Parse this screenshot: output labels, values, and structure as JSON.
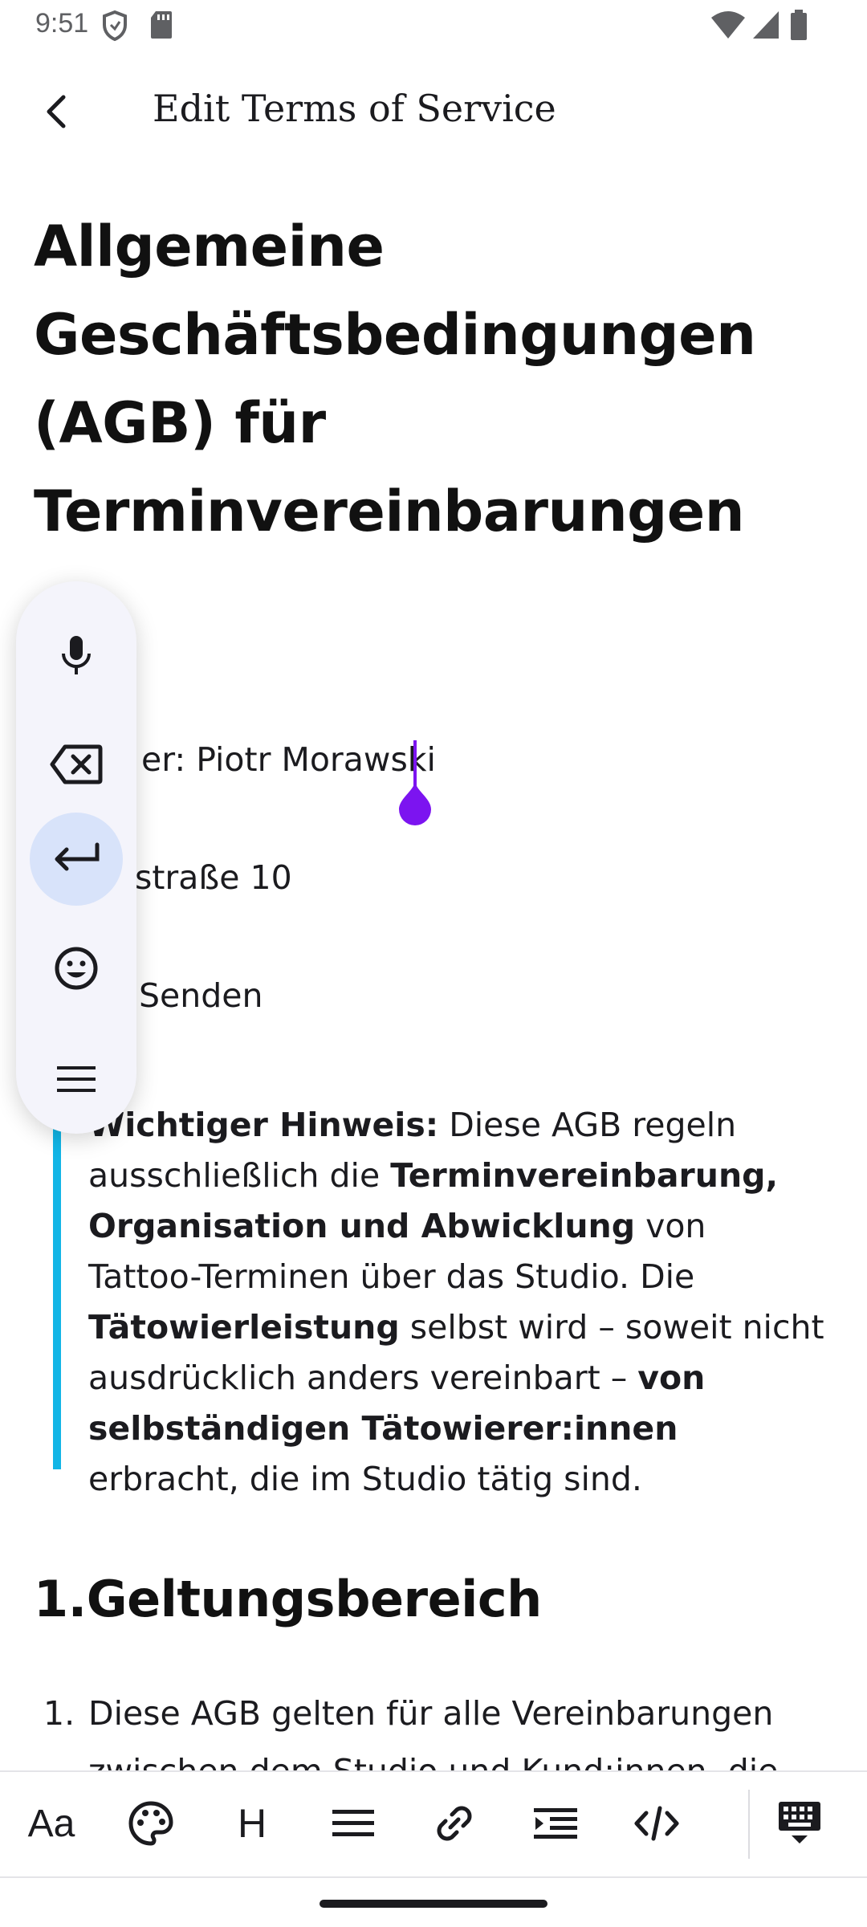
{
  "status_bar": {
    "time": "9:51"
  },
  "app_bar": {
    "title": "Edit Terms of Service"
  },
  "document": {
    "title": "Allgemeine Geschäftsbedingungen (AGB) für Terminvereinbarungen",
    "line_owner": "er: Piotr Morawski",
    "line_street": "straße 10",
    "line_city": "Senden",
    "note": {
      "p1_bold": "Wichtiger Hinweis:",
      "p1_rest": " Diese AGB regeln ausschließlich die ",
      "p2_bold": "Terminvereinbarung, Organisation und Abwicklung",
      "p2_rest": " von Tattoo-Terminen über das Studio. Die ",
      "p3_bold": "Tätowierleistung",
      "p3_rest": " selbst wird – soweit nicht ausdrücklich anders vereinbart – ",
      "p4_bold": "von selbständigen Tätowierer:innen",
      "p4_rest": " erbracht, die im Studio tätig sind."
    },
    "section_heading": "1.Geltungsbereich",
    "list_item_1_number": "1.",
    "list_item_1_text": "Diese AGB gelten für alle Vereinbarungen",
    "list_item_1_continued": "zwischen dem Studio und Kund:innen, die"
  },
  "floating_toolbar": {
    "items": [
      {
        "icon": "microphone-icon"
      },
      {
        "icon": "backspace-icon"
      },
      {
        "icon": "enter-icon",
        "active": true
      },
      {
        "icon": "emoji-icon"
      },
      {
        "icon": "menu-icon"
      }
    ]
  },
  "format_toolbar": {
    "text_style_label": "Aa",
    "heading_label": "H",
    "items": [
      "text-style-icon",
      "palette-icon",
      "heading-icon",
      "align-icon",
      "link-icon",
      "indent-icon",
      "code-icon",
      "keyboard-hide-icon"
    ]
  },
  "colors": {
    "cursor": "#7c14f0",
    "blockquote_bar": "#12b5e6",
    "active_button_bg": "#d8e3fa",
    "floating_toolbar_bg": "#f4f4fb"
  }
}
